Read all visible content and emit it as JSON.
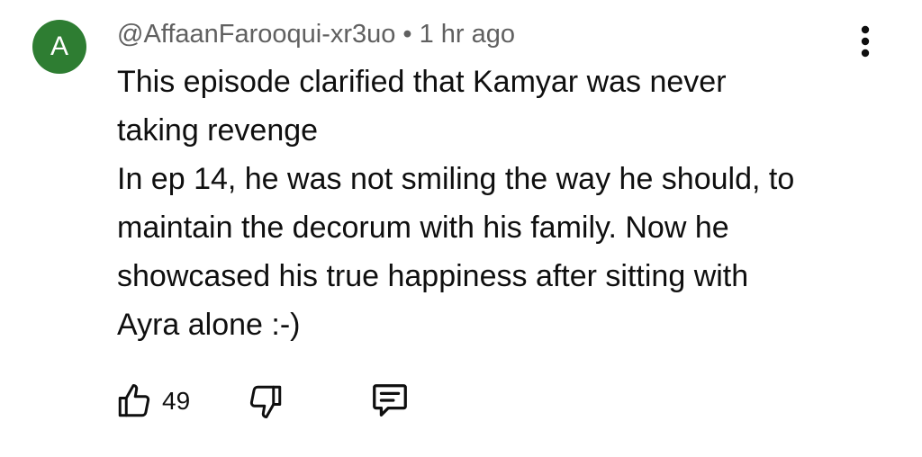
{
  "comment": {
    "avatar_letter": "A",
    "avatar_color": "#2e7d32",
    "author": "@AffaanFarooqui-xr3uo",
    "separator": "•",
    "time": "1 hr ago",
    "text_lines": [
      "This episode clarified that Kamyar was never",
      "taking revenge",
      "In ep 14, he was not smiling the way he should, to",
      "maintain the decorum with his family. Now he",
      "showcased his true happiness after sitting with",
      "Ayra alone :-)"
    ],
    "like_count": "49",
    "icons": {
      "more": "more-vertical-icon",
      "like": "thumbs-up-icon",
      "dislike": "thumbs-down-icon",
      "reply": "reply-comment-icon"
    }
  }
}
